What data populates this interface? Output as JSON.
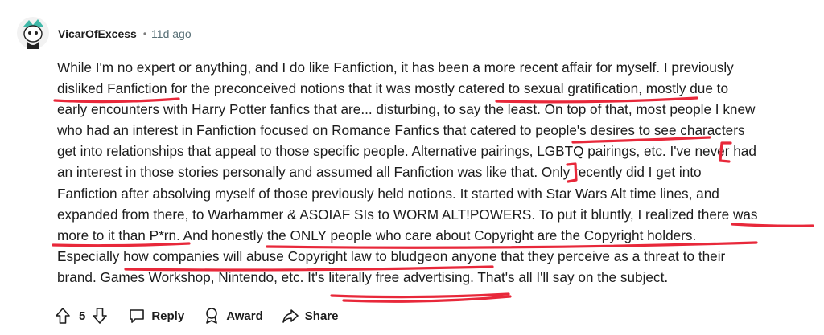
{
  "comment": {
    "author": "VicarOfExcess",
    "separator": "•",
    "age": "11d ago",
    "lines": [
      "While I'm no expert or anything, and I do like Fanfiction, it has been a more recent affair for myself. I previously",
      "disliked Fanfiction for the preconceived notions that it was mostly catered to sexual gratification, mostly due to",
      "early encounters with Harry Potter fanfics that are... disturbing, to say the least. On top of that, most people I knew",
      "who had an interest in Fanfiction focused on Romance Fanfics that catered to people's desires to see characters",
      "get into relationships that appeal to those specific people. Alternative pairings, LGBTQ pairings, etc. I've never had",
      "an interest in those stories personally and assumed all Fanfiction was like that. Only recently did I get into",
      "Fanfiction after absolving myself of those previously held notions. It started with Star Wars Alt time lines, and",
      "expanded from there, to Warhammer & ASOIAF SIs to WORM ALT!POWERS. To put it bluntly, I realized there was",
      "more to it than P*rn. And honestly the ONLY people who care about Copyright are the Copyright holders.",
      "Especially how companies will abuse Copyright law to bludgeon anyone that they perceive as a threat to their",
      "brand. Games Workshop, Nintendo, etc. It's literally free advertising. That's all I'll say on the subject."
    ]
  },
  "actions": {
    "vote_count": "5",
    "reply_label": "Reply",
    "award_label": "Award",
    "share_label": "Share"
  },
  "colors": {
    "annotation": "#e8283a",
    "meta_text": "#576f76",
    "avatar_accent": "#3fb8a8"
  },
  "icons": [
    "avatar",
    "upvote-icon",
    "downvote-icon",
    "reply-icon",
    "award-icon",
    "share-icon"
  ]
}
